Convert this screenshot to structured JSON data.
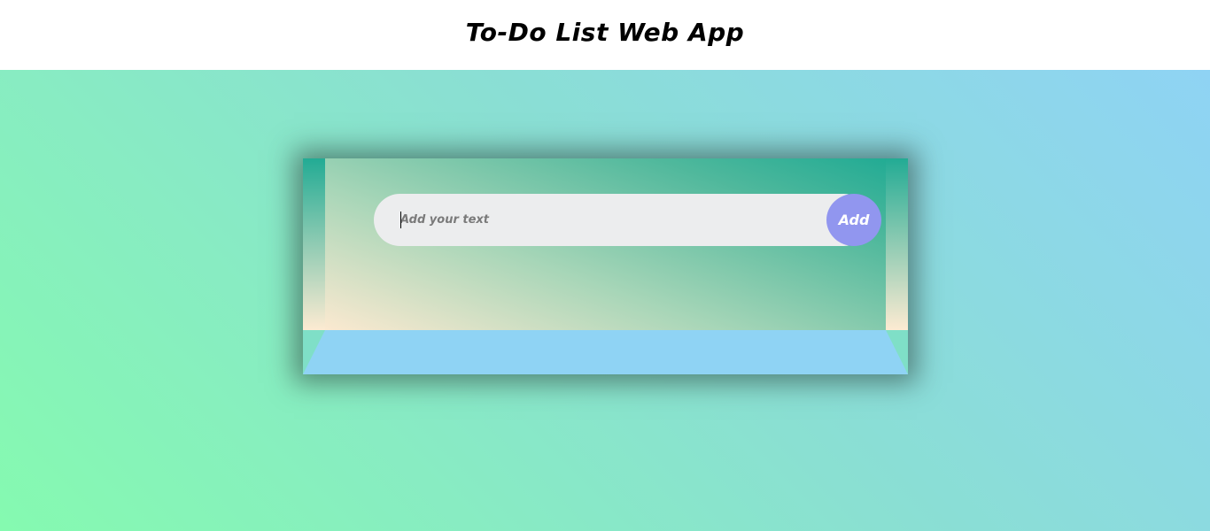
{
  "header": {
    "title": "To-Do List Web App"
  },
  "todo": {
    "input_placeholder": "Add your text",
    "input_value": "",
    "add_label": "Add"
  },
  "colors": {
    "header_bg": "#ffffff",
    "page_gradient": [
      "#85fab0",
      "#8fd3f4"
    ],
    "panel_gradient_top": "#22ab94",
    "panel_gradient_bottom": "#fdebd2",
    "bottom_bar": "#8fd3f4",
    "input_bg": "#ecedee",
    "add_button": "#9196ef"
  }
}
